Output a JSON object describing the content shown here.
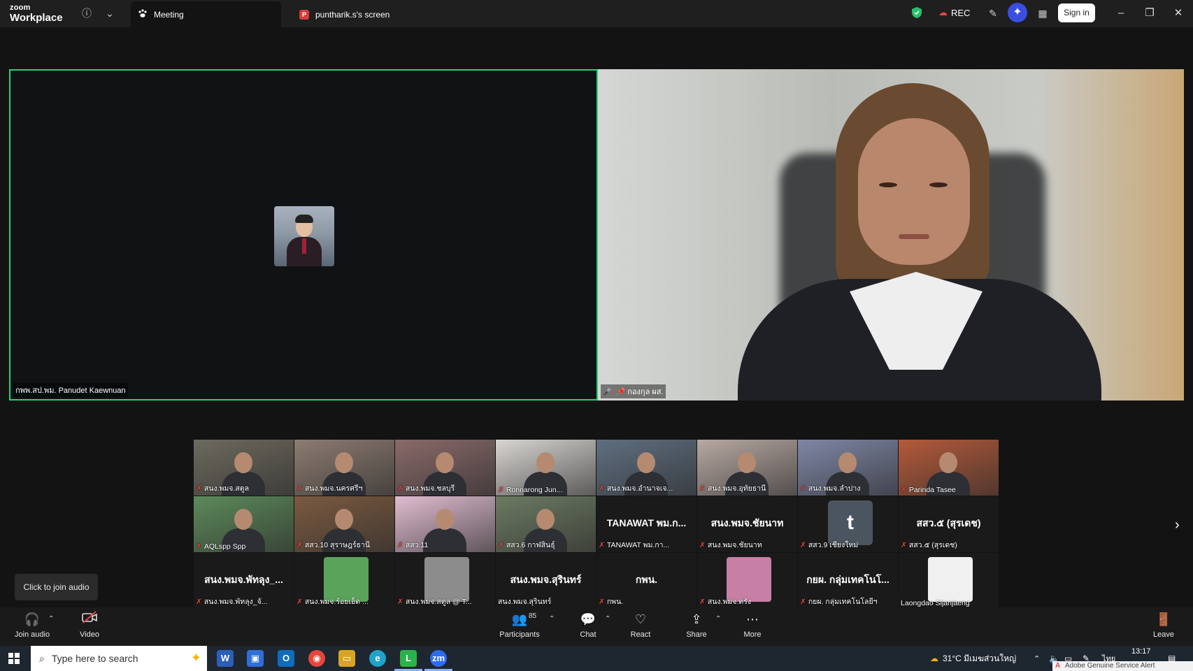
{
  "app": {
    "brand_small": "zoom",
    "brand_large": "Workplace"
  },
  "tabs": [
    {
      "label": "Meeting"
    },
    {
      "label": "puntharik.s's screen"
    }
  ],
  "titlebar": {
    "rec_label": "REC",
    "signin_label": "Sign in"
  },
  "videos": {
    "left_name": "กพพ.สป.พม. Panudet Kaewnuan",
    "right_name": "กองกุล ผส."
  },
  "grid": {
    "tiles": [
      {
        "label": "สนง.พมจ.สตูล",
        "kind": "video",
        "color": "#6d6a5e"
      },
      {
        "label": "สนง.พมจ.นครศรีฯ",
        "kind": "video",
        "color": "#8d7c72"
      },
      {
        "label": "สนง.พมจ.ชลบุรี",
        "kind": "video",
        "color": "#8a6a6a"
      },
      {
        "label": "Ronnarong Jun...",
        "kind": "video",
        "color": "#d8d6d2"
      },
      {
        "label": "สนง.พมจ.อำนาจเจ...",
        "kind": "video",
        "color": "#5f6f80"
      },
      {
        "label": "สนง.พมจ.อุทัยธานี",
        "kind": "video",
        "color": "#b8a9a3"
      },
      {
        "label": "สนง.พมจ.ลำปาง",
        "kind": "video",
        "color": "#7f87a6"
      },
      {
        "label": "Parinda Tasee",
        "kind": "video",
        "color": "#b45a3a"
      },
      {
        "label": "AQLspp Spp",
        "kind": "video",
        "color": "#5c8a5a"
      },
      {
        "label": "สสว.10 สุราษฎร์ธานี",
        "kind": "video",
        "color": "#7b5a40"
      },
      {
        "label": "สสว.11",
        "kind": "video",
        "color": "#e0bdd0"
      },
      {
        "label": "สสว.6 กาฬสินธุ์",
        "kind": "video",
        "color": "#6c7a62"
      },
      {
        "label": "TANAWAT พม.กา...",
        "kind": "name",
        "big": "TANAWAT พม.ก..."
      },
      {
        "label": "สนง.พมจ.ชัยนาท",
        "kind": "name",
        "big": "สนง.พมจ.ชัยนาท"
      },
      {
        "label": "สสว.9 เชียงใหม่",
        "kind": "letter",
        "big": "t"
      },
      {
        "label": "สสว.๕ (สุรเดช)",
        "kind": "name",
        "big": "สสว.๕ (สุรเดช)"
      },
      {
        "label": "สนง.พมจ.พัทลุง_จั...",
        "kind": "name",
        "big": "สนง.พมจ.พัทลุง_..."
      },
      {
        "label": "สนง.พมจ.ร้อยเอ็ด ...",
        "kind": "photo",
        "color": "#5aa35a"
      },
      {
        "label": "สนง.พมจ.สตูล @ T...",
        "kind": "photo",
        "color": "#8c8c8c"
      },
      {
        "label": "สนง.พมจ.สุรินทร์",
        "kind": "name",
        "big": "สนง.พมจ.สุรินทร์"
      },
      {
        "label": "กพน.",
        "kind": "name",
        "big": "กพน."
      },
      {
        "label": "สนง.พมจ.ตรัง",
        "kind": "photo",
        "color": "#c77fa6"
      },
      {
        "label": "กยผ. กลุ่มเทคโนโลยีฯ",
        "kind": "name",
        "big": "กยผ. กลุ่มเทคโนโ..."
      },
      {
        "label": "Laongdao Sijanjaeng",
        "kind": "photo",
        "color": "#f0f0f0"
      }
    ]
  },
  "join_popup": "Click to join audio",
  "toolbar": {
    "join_audio": "Join audio",
    "video": "Video",
    "participants": "Participants",
    "participants_count": "85",
    "chat": "Chat",
    "react": "React",
    "share": "Share",
    "more": "More",
    "leave": "Leave"
  },
  "taskbar": {
    "search_placeholder": "Type here to search",
    "weather": "31°C มีเมฆส่วนใหญ่",
    "time": "13:17",
    "lang": "ไทย",
    "alert": "Adobe Genuine Service Alert"
  },
  "colors": {
    "active_speaker": "#23d37a",
    "mic_off": "#e34646",
    "accent": "#3a4fe0"
  }
}
